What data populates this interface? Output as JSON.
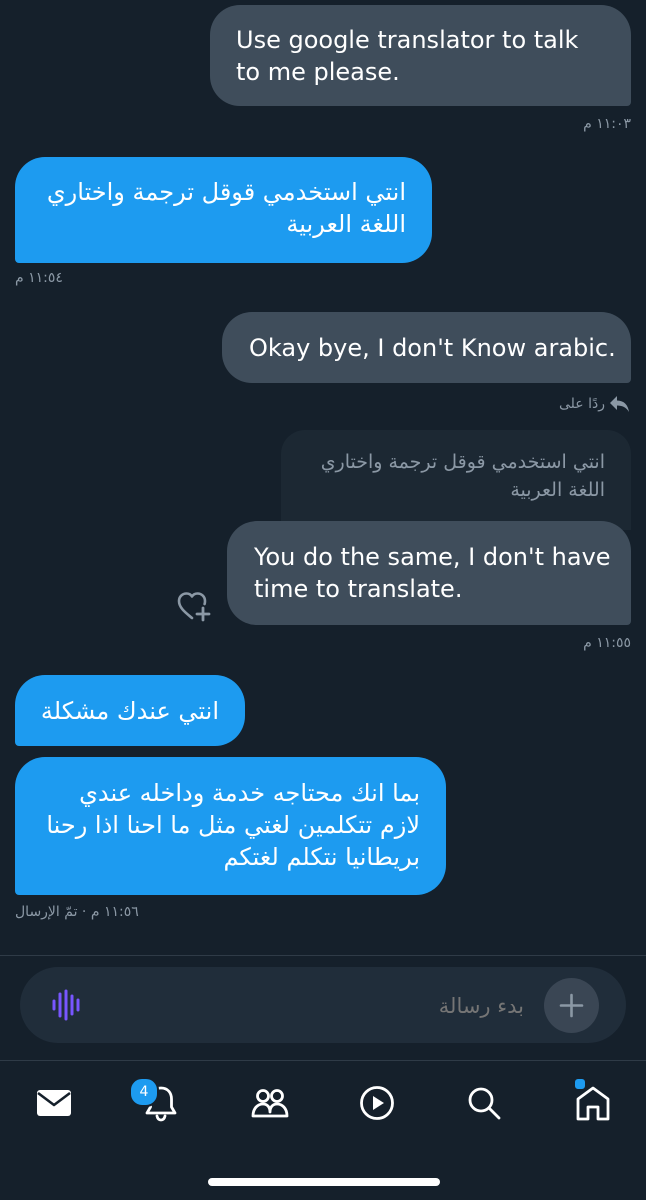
{
  "colors": {
    "background": "#15202b",
    "sent_bubble": "#3f4d5b",
    "received_bubble": "#1d9bf0",
    "meta_text": "#8b98a5",
    "accent": "#1d9bf0",
    "voice_icon": "#7856ff"
  },
  "messages": [
    {
      "direction": "sent",
      "text": "Use google translator to talk to me please.",
      "time": "١١:٠٣ م"
    },
    {
      "direction": "received",
      "text": "انتي استخدمي قوقل ترجمة واختاري اللغة العربية",
      "time": "١١:٥٤ م"
    },
    {
      "direction": "sent",
      "text": "Okay bye, I don't Know arabic.",
      "reply_label": "ردًا على",
      "reply_icon": "reply-arrow-icon"
    },
    {
      "direction": "sent",
      "quoted": "انتي استخدمي قوقل ترجمة واختاري اللغة العربية",
      "text": "You do the same, I don't have time to translate.",
      "time": "١١:٥٥ م",
      "reaction_icon": "add-reaction-heart-icon"
    },
    {
      "direction": "received",
      "text": "انتي عندك مشكلة"
    },
    {
      "direction": "received",
      "lines": [
        "بما انك محتاجه خدمة وداخله عندي",
        "لازم تتكلمين لغتي مثل ما احنا اذا رحنا",
        "بريطانيا نتكلم لغتكم"
      ],
      "time": "١١:٥٦ م · تمّ الإرسال"
    }
  ],
  "composer": {
    "placeholder": "بدء رسالة",
    "voice_icon": "voice-waveform-icon",
    "add_icon": "plus-icon"
  },
  "nav": {
    "items": [
      "messages-icon",
      "notifications-icon",
      "communities-icon",
      "video-icon",
      "search-icon",
      "home-icon"
    ],
    "notifications_badge": "4",
    "home_has_dot": true
  }
}
